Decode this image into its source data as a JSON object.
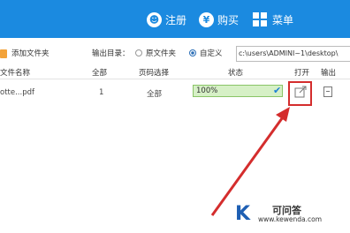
{
  "topbar": {
    "register_label": "注册",
    "buy_label": "购买",
    "menu_label": "菜单",
    "register_icon": "user-icon",
    "buy_icon": "yen-icon",
    "menu_icon": "grid-icon",
    "bg_color": "#1b8ae0"
  },
  "toolbar": {
    "add_folder_label": "添加文件夹",
    "output_dir_label": "输出目录：",
    "option_original": "原文件夹",
    "option_custom": "自定义",
    "selected_option": "自定义",
    "output_path": "c:\\users\\ADMINI~1\\desktop\\"
  },
  "table": {
    "headers": {
      "file_name": "文件名称",
      "all": "全部",
      "page_select": "页码选择",
      "status": "状态",
      "open": "打开",
      "output": "输出"
    },
    "rows": [
      {
        "file_name": "otte...pdf",
        "all": "1",
        "page_select": "全部",
        "status": "100%",
        "progress": 1.0
      }
    ]
  },
  "annotation": {
    "highlight_color": "#d42d2d"
  },
  "watermark": {
    "logo": "K",
    "title": "可问答",
    "url": "www.kewenda.com"
  }
}
